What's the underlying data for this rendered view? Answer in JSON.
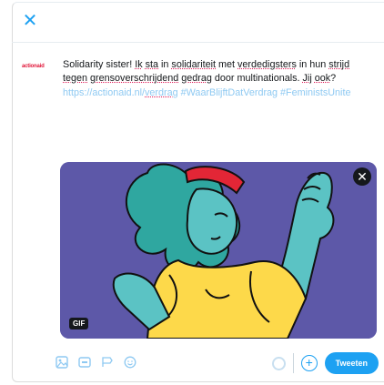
{
  "dialog": {
    "close_glyph": "✕"
  },
  "author": {
    "avatar_text": "actionaid",
    "brand_color": "#e1173a"
  },
  "compose": {
    "segments": [
      {
        "t": "Solidarity sister! ",
        "s": "plain"
      },
      {
        "t": "Ik",
        "s": "u"
      },
      {
        "t": " ",
        "s": "plain"
      },
      {
        "t": "sta",
        "s": "u"
      },
      {
        "t": " in ",
        "s": "plain"
      },
      {
        "t": "solidariteit",
        "s": "u"
      },
      {
        "t": " met ",
        "s": "plain"
      },
      {
        "t": "verdedigsters",
        "s": "u"
      },
      {
        "t": " in hun ",
        "s": "plain"
      },
      {
        "t": "strijd",
        "s": "u"
      },
      {
        "t": " ",
        "s": "plain"
      },
      {
        "t": "tegen",
        "s": "u"
      },
      {
        "t": " ",
        "s": "plain"
      },
      {
        "t": "grensoverschrijdend",
        "s": "u"
      },
      {
        "t": " ",
        "s": "plain"
      },
      {
        "t": "gedrag",
        "s": "u"
      },
      {
        "t": " door multinationals. ",
        "s": "plain"
      },
      {
        "t": "Jij",
        "s": "u"
      },
      {
        "t": " ",
        "s": "plain"
      },
      {
        "t": "ook",
        "s": "u"
      },
      {
        "t": "? ",
        "s": "plain"
      },
      {
        "t": "https://actionaid.nl/",
        "s": "link"
      },
      {
        "t": "verdrag",
        "s": "linku"
      },
      {
        "t": " ",
        "s": "plain"
      },
      {
        "t": "#WaarBlijftDatVerdrag #FeministsUnite",
        "s": "hash"
      }
    ]
  },
  "media": {
    "close_glyph": "✕",
    "gif_badge": "GIF",
    "background_color": "#5d58a8"
  },
  "toolbar": {
    "icons": [
      "image-icon",
      "gif-icon",
      "poll-icon",
      "emoji-icon"
    ],
    "add_glyph": "+",
    "tweet_label": "Tweeten",
    "accent_color": "#1da1f2"
  }
}
